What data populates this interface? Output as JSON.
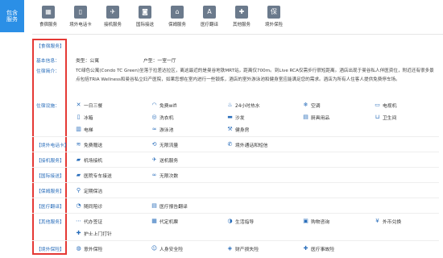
{
  "left_tab": [
    "包含",
    "服务"
  ],
  "top_services": [
    {
      "label": "食宿服务",
      "icon": "building-icon",
      "glyph": "▦"
    },
    {
      "label": "境外电话卡",
      "icon": "sim-card-icon",
      "glyph": "▯"
    },
    {
      "label": "接机服务",
      "icon": "plane-icon",
      "glyph": "✈"
    },
    {
      "label": "国际接送",
      "icon": "passport-icon",
      "glyph": "◙"
    },
    {
      "label": "保姆服务",
      "icon": "cleaning-icon",
      "glyph": "⌂"
    },
    {
      "label": "医疗翻译",
      "icon": "translate-icon",
      "glyph": "A"
    },
    {
      "label": "其他服务",
      "icon": "grid-icon",
      "glyph": "✚"
    },
    {
      "label": "境外保险",
      "icon": "insurance-icon",
      "glyph": "保"
    }
  ],
  "sections": {
    "lodging": "【食宿服务】",
    "basic_info": "基本信息：",
    "intro_label": "住宿简介：",
    "facilities_label": "住宿设施：",
    "phone": "【境外电话卡】",
    "pickup": "【接机服务】",
    "transfer": "【国际接送】",
    "nanny": "【保姆服务】",
    "medical": "【医疗翻译】",
    "other": "【其他服务】",
    "insurance": "【境外保险】"
  },
  "basic": {
    "type": "类型：公寓",
    "layout": "户型：一室一厅"
  },
  "intro": "TC绿色公寓(Condo TC Green)坐落于拉差达拉区，离这最近的是曼谷地铁MRT站，距离仅700m。到Live RCA仅需步行很短距离。酒店出现于曼谷私人伴医资位，附近还有很多景点包括TRIA Wellness和曼谷私立妇产医院，如果您想在室内进行一些锻炼，酒店的室外游泳池和健身室应能满足您的需求。酒店为所有人住客人提供免费停车场。",
  "facilities": [
    {
      "label": "一日三餐",
      "icon": "fork-knife-icon",
      "glyph": "✕"
    },
    {
      "label": "免费wifi",
      "icon": "wifi-icon",
      "glyph": "◠"
    },
    {
      "label": "24小时热水",
      "icon": "water-icon",
      "glyph": "♨"
    },
    {
      "label": "空调",
      "icon": "air-conditioner-icon",
      "glyph": "❄"
    },
    {
      "label": "电视机",
      "icon": "tv-icon",
      "glyph": "▭"
    },
    {
      "label": "冰箱",
      "icon": "fridge-icon",
      "glyph": "▯"
    },
    {
      "label": "洗衣机",
      "icon": "washer-icon",
      "glyph": "◎"
    },
    {
      "label": "沙发",
      "icon": "sofa-icon",
      "glyph": "▬"
    },
    {
      "label": "厨具用品",
      "icon": "kitchenware-icon",
      "glyph": "▤"
    },
    {
      "label": "卫生间",
      "icon": "toilet-icon",
      "glyph": "⊔"
    },
    {
      "label": "电梯",
      "icon": "elevator-icon",
      "glyph": "▥"
    },
    {
      "label": "游泳池",
      "icon": "pool-icon",
      "glyph": "≈"
    },
    {
      "label": "健身房",
      "icon": "gym-icon",
      "glyph": "⚒"
    }
  ],
  "phone_items": [
    {
      "label": "免费赠送",
      "icon": "gift-icon",
      "glyph": "≋"
    },
    {
      "label": "无限流量",
      "icon": "data-icon",
      "glyph": "⟲"
    },
    {
      "label": "境外通话和短信",
      "icon": "phone-icon",
      "glyph": "✆"
    }
  ],
  "pickup_items": [
    {
      "label": "机场接机",
      "icon": "car-icon",
      "glyph": "▰"
    },
    {
      "label": "送机服务",
      "icon": "plane-takeoff-icon",
      "glyph": "✈"
    }
  ],
  "transfer_items": [
    {
      "label": "医院专车接送",
      "icon": "van-icon",
      "glyph": "▰"
    },
    {
      "label": "无限次数",
      "icon": "infinity-icon",
      "glyph": "∞"
    }
  ],
  "nanny_items": [
    {
      "label": "定期保洁",
      "icon": "broom-icon",
      "glyph": "⚲"
    }
  ],
  "medical_items": [
    {
      "label": "随同陪诊",
      "icon": "companion-icon",
      "glyph": "◔"
    },
    {
      "label": "医疗报告翻译",
      "icon": "document-icon",
      "glyph": "▤"
    }
  ],
  "other_items": [
    {
      "label": "代办签证",
      "icon": "visa-icon",
      "glyph": "⋯"
    },
    {
      "label": "代定机票",
      "icon": "ticket-icon",
      "glyph": "▦"
    },
    {
      "label": "生活指导",
      "icon": "guide-icon",
      "glyph": "◑"
    },
    {
      "label": "购物咨询",
      "icon": "shopping-icon",
      "glyph": "▣"
    },
    {
      "label": "外币兑换",
      "icon": "currency-icon",
      "glyph": "¥"
    },
    {
      "label": "护士上门打针",
      "icon": "nurse-icon",
      "glyph": "✚"
    }
  ],
  "insurance_items": [
    {
      "label": "意外保险",
      "icon": "accident-icon",
      "glyph": "◍"
    },
    {
      "label": "人身安全险",
      "icon": "person-icon",
      "glyph": "☺"
    },
    {
      "label": "财产损失险",
      "icon": "property-icon",
      "glyph": "◈"
    },
    {
      "label": "医疗事故险",
      "icon": "medical-icon",
      "glyph": "✚"
    }
  ]
}
